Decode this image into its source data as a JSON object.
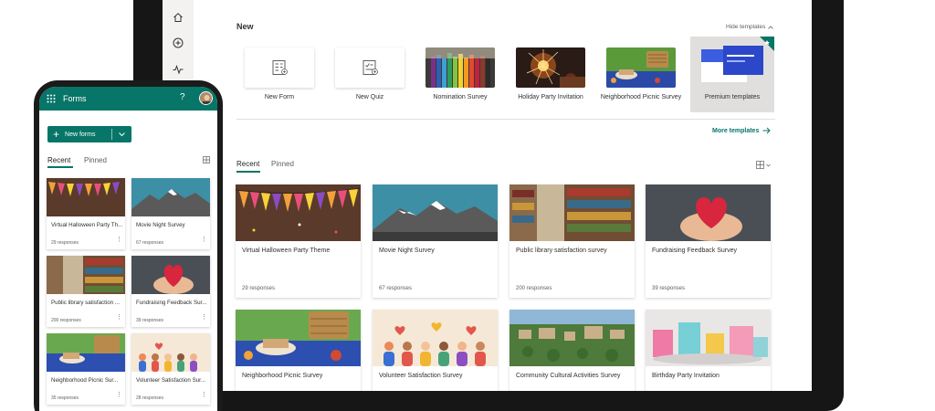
{
  "desktop": {
    "new_heading": "New",
    "hide_templates": "Hide templates",
    "templates": [
      {
        "label": "New Form",
        "icon": "form-icon"
      },
      {
        "label": "New Quiz",
        "icon": "quiz-icon"
      },
      {
        "label": "Nomination Survey",
        "icon": "pencils-image"
      },
      {
        "label": "Holiday Party Invitation",
        "icon": "sparkler-image"
      },
      {
        "label": "Neighborhood Picnic Survey",
        "icon": "picnic-image"
      },
      {
        "label": "Premium templates",
        "icon": "premium-image"
      }
    ],
    "more_templates": "More templates",
    "tabs": [
      "Recent",
      "Pinned"
    ],
    "cards": [
      {
        "title": "Virtual Halloween Party Theme",
        "responses": "29 responses"
      },
      {
        "title": "Movie Night Survey",
        "responses": "67 responses"
      },
      {
        "title": "Public library satisfaction survey",
        "responses": "200 responses"
      },
      {
        "title": "Fundraising Feedback Survey",
        "responses": "39 responses"
      },
      {
        "title": "Neighborhood Picnic Survey",
        "responses": ""
      },
      {
        "title": "Volunteer Satisfaction Survey",
        "responses": ""
      },
      {
        "title": "Community Cultural Activities Survey",
        "responses": ""
      },
      {
        "title": "Birthday Party Invitation",
        "responses": ""
      }
    ]
  },
  "phone": {
    "app_title": "Forms",
    "help": "?",
    "new_forms": "New forms",
    "tabs": [
      "Recent",
      "Pinned"
    ],
    "cards": [
      {
        "title": "Virtual Halloween Party Th...",
        "responses": "29 responses"
      },
      {
        "title": "Movie Night Survey",
        "responses": "67 responses"
      },
      {
        "title": "Public library satisfaction ...",
        "responses": "200 responses"
      },
      {
        "title": "Fundraising Feedback Sur...",
        "responses": "39 responses"
      },
      {
        "title": "Neighborhood Picnic Sur...",
        "responses": "35 responses"
      },
      {
        "title": "Volunteer Satisfaction Sur...",
        "responses": "28 responses"
      }
    ]
  },
  "colors": {
    "accent": "#077568",
    "rail": "#f3f2f1",
    "text": "#323130",
    "muted": "#605e5c"
  }
}
